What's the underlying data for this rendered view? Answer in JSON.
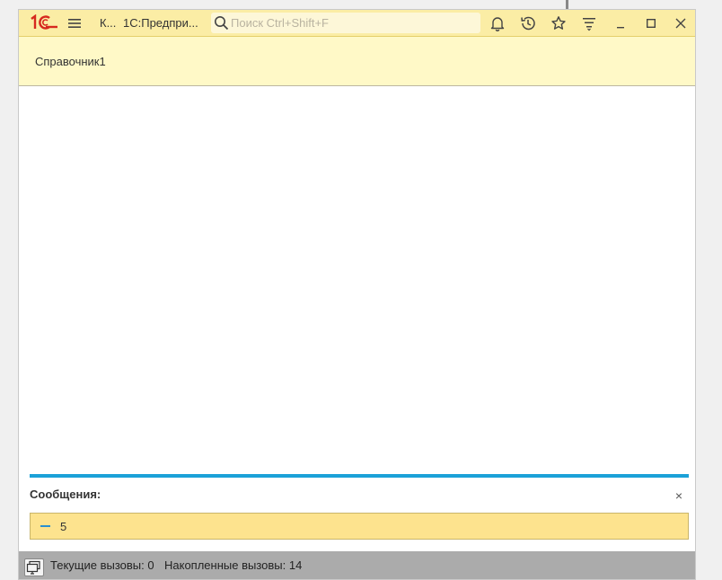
{
  "window": {
    "logo_text": "1С",
    "title_short": "К...",
    "title_app": "1С:Предпри...",
    "search_placeholder": "Поиск Ctrl+Shift+F"
  },
  "form": {
    "title": "Справочник1"
  },
  "messages": {
    "header": "Сообщения:",
    "close_glyph": "×",
    "items": [
      {
        "text": "5"
      }
    ]
  },
  "statusbar": {
    "current_calls": "Текущие вызовы: 0",
    "accumulated_calls": "Накопленные вызовы: 14"
  },
  "colors": {
    "titlebar": "#fbeda5",
    "header": "#fff9c7",
    "accent": "#1ba1d8",
    "message_bg": "#fde38e",
    "statusbar": "#ababab",
    "logo": "#d6281e"
  },
  "icons": {
    "menu": "hamburger-icon",
    "search": "search-icon",
    "notifications": "bell-icon",
    "history": "history-icon",
    "favorites": "star-icon",
    "functions": "functions-menu-icon",
    "minimize": "minimize-icon",
    "maximize": "maximize-icon",
    "close": "close-icon",
    "status": "computer-icon"
  }
}
